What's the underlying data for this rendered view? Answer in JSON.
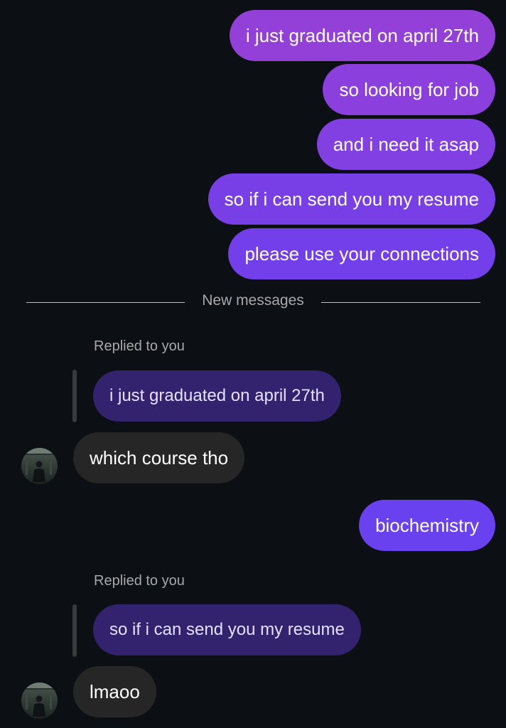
{
  "outgoing": [
    {
      "text": "i just graduated on april 27th"
    },
    {
      "text": "so looking for job"
    },
    {
      "text": "and i need it asap"
    },
    {
      "text": "so if i can send you my resume"
    },
    {
      "text": "please use your connections"
    }
  ],
  "separator": {
    "label": "New messages"
  },
  "reply1": {
    "header": "Replied to you",
    "quoted": "i just graduated on april 27th",
    "message": "which course tho"
  },
  "outgoing2": {
    "text": "biochemistry"
  },
  "reply2": {
    "header": "Replied to you",
    "quoted": "so if i can send you my resume",
    "message": "lmaoo"
  },
  "colors": {
    "background": "#0c0f14",
    "outgoing_gradient_top": "#9241d9",
    "outgoing_gradient_bottom": "#6a3ff0",
    "incoming_bubble": "#262626",
    "quoted_bubble": "#33236f"
  }
}
